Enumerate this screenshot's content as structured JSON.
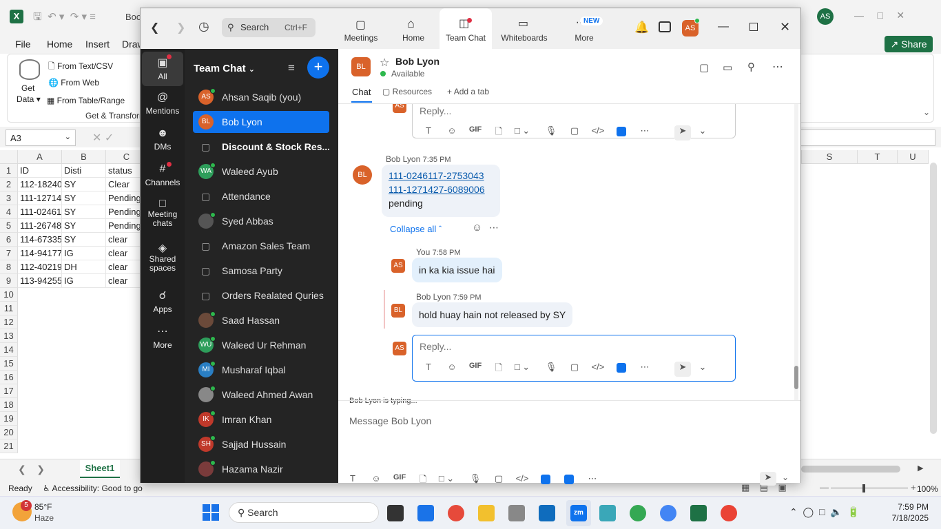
{
  "excel": {
    "title": "Boo",
    "menu": [
      "File",
      "Home",
      "Insert",
      "Draw"
    ],
    "share_label": "Share",
    "ribbon": {
      "get_data_1": "Get",
      "get_data_2": "Data",
      "from_text": "From Text/CSV",
      "from_web": "From Web",
      "from_table": "From Table/Range",
      "group_label": "Get & Transform"
    },
    "name_box": "A3",
    "columns": [
      "A",
      "B",
      "C"
    ],
    "right_columns": [
      "S",
      "T",
      "U"
    ],
    "rows": [
      "1",
      "2",
      "3",
      "4",
      "5",
      "6",
      "7",
      "8",
      "9",
      "10",
      "11",
      "12",
      "13",
      "14",
      "15",
      "16",
      "17",
      "18",
      "19",
      "20",
      "21"
    ],
    "cells": [
      [
        "ID",
        "Disti",
        "status"
      ],
      [
        "112-18240",
        "SY",
        "Clear"
      ],
      [
        "111-12714",
        "SY",
        "Pending"
      ],
      [
        "111-02461",
        "SY",
        "Pending"
      ],
      [
        "111-26748",
        "SY",
        "Pending"
      ],
      [
        "114-67335",
        "SY",
        "clear"
      ],
      [
        "114-94177",
        "IG",
        "clear"
      ],
      [
        "112-40219",
        "DH",
        "clear"
      ],
      [
        "113-94255",
        "IG",
        "clear"
      ]
    ],
    "sheet_tab": "Sheet1",
    "status_ready": "Ready",
    "status_accessibility": "Accessibility: Good to go",
    "zoom_pct": "100%",
    "avatar": "AS"
  },
  "taskbar": {
    "weather_temp": "85°F",
    "weather_desc": "Haze",
    "weather_badge": "5",
    "search": "Search",
    "time": "7:59 PM",
    "date": "7/18/2025"
  },
  "zoom": {
    "search_placeholder": "Search",
    "search_shortcut": "Ctrl+F",
    "nav": [
      {
        "label": "Meetings"
      },
      {
        "label": "Home"
      },
      {
        "label": "Team Chat"
      },
      {
        "label": "Whiteboards"
      },
      {
        "label": "More"
      }
    ],
    "new_badge": "NEW",
    "user_avatar": "AS",
    "rail": [
      {
        "label": "All"
      },
      {
        "label": "Mentions"
      },
      {
        "label": "DMs"
      },
      {
        "label": "Channels"
      },
      {
        "label": "Meeting chats"
      },
      {
        "label": "Shared spaces"
      },
      {
        "label": "Apps"
      },
      {
        "label": "More"
      }
    ],
    "sidebar_title": "Team Chat",
    "channels": [
      {
        "name": "Ahsan Saqib (you)",
        "initials": "AS",
        "color": "#d9622a"
      },
      {
        "name": "Bob Lyon",
        "initials": "BL",
        "color": "#d9622a"
      },
      {
        "name": "Discount & Stock Res...",
        "initials": "",
        "color": ""
      },
      {
        "name": "Waleed Ayub",
        "initials": "WA",
        "color": "#2e9e5b"
      },
      {
        "name": "Attendance",
        "initials": "",
        "color": ""
      },
      {
        "name": "Syed Abbas",
        "initials": "",
        "color": "#555"
      },
      {
        "name": "Amazon Sales Team",
        "initials": "",
        "color": ""
      },
      {
        "name": "Samosa Party",
        "initials": "",
        "color": ""
      },
      {
        "name": "Orders Realated Quries",
        "initials": "",
        "color": ""
      },
      {
        "name": "Saad Hassan",
        "initials": "",
        "color": "#6b4a3a"
      },
      {
        "name": "Waleed Ur Rehman",
        "initials": "WU",
        "color": "#2e9e5b"
      },
      {
        "name": "Musharaf Iqbal",
        "initials": "MI",
        "color": "#2a7fc4"
      },
      {
        "name": "Waleed Ahmed Awan",
        "initials": "",
        "color": "#888"
      },
      {
        "name": "Imran Khan",
        "initials": "IK",
        "color": "#c0392b"
      },
      {
        "name": "Sajjad Hussain",
        "initials": "SH",
        "color": "#c0392b"
      },
      {
        "name": "Hazama Nazir",
        "initials": "",
        "color": "#7a3b3b"
      }
    ],
    "chat_name": "Bob Lyon",
    "chat_initials": "BL",
    "chat_status": "Available",
    "tabs": {
      "chat": "Chat",
      "resources": "Resources",
      "add_tab": "Add a tab"
    },
    "top_reply_placeholder": "Reply...",
    "message": {
      "sender": "Bob Lyon",
      "time": "7:35 PM",
      "line1_a": "111-0246117",
      "line1_sep": "-",
      "line1_b": "2753043",
      "line2_a": "111-1271427",
      "line2_sep": "-",
      "line2_b": "6089006",
      "line3": "pending"
    },
    "collapse_all": "Collapse all",
    "replies": [
      {
        "sender": "You",
        "time": "7:58 PM",
        "text": "in ka kia issue hai",
        "initials": "AS"
      },
      {
        "sender": "Bob Lyon",
        "time": "7:59 PM",
        "text": "hold huay hain not released by SY",
        "initials": "BL"
      }
    ],
    "reply_placeholder": "Reply...",
    "reply_avatar": "AS",
    "typing": "Bob Lyon  is typing...",
    "message_placeholder": "Message Bob Lyon",
    "gif": "GIF"
  }
}
